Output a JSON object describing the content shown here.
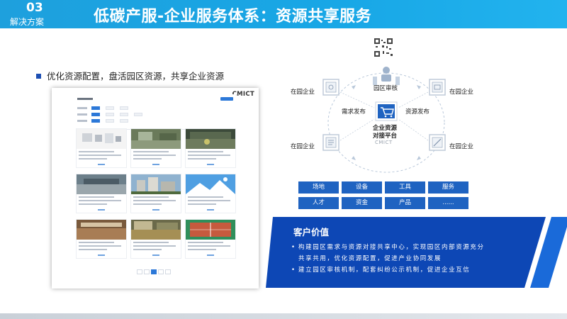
{
  "header": {
    "section_number": "03",
    "section_label": "解决方案",
    "title": "低碳产服-企业服务体系：资源共享服务"
  },
  "bullet": {
    "text": "优化资源配置，盘活园区资源，共享企业资源"
  },
  "portal": {
    "brand": "CMICT"
  },
  "diagram": {
    "enterprises": [
      "在园企业",
      "在园企业",
      "在园企业",
      "在园企业"
    ],
    "audit_label": "园区审核",
    "demand_label": "需求发布",
    "resource_label": "资源发布",
    "platform_line1": "企业资源",
    "platform_line2": "对接平台",
    "platform_brand": "CMICT"
  },
  "resources": [
    "场地",
    "设备",
    "工具",
    "服务",
    "人才",
    "资金",
    "产品",
    "......"
  ],
  "value": {
    "title": "客户价值",
    "items": [
      {
        "bullet": "•",
        "line1": "构建园区需求与资源对接共享中心，实现园区内部资源充分",
        "line2": "共享共用，优化资源配置，促进产业协同发展"
      },
      {
        "bullet": "•",
        "line1": "建立园区审核机制，配套纠纷公示机制，促进企业互信"
      }
    ]
  },
  "colors": {
    "header": "#1ea0dd",
    "accent_blue": "#1f63c1",
    "band_blue": "#0d47b5"
  }
}
